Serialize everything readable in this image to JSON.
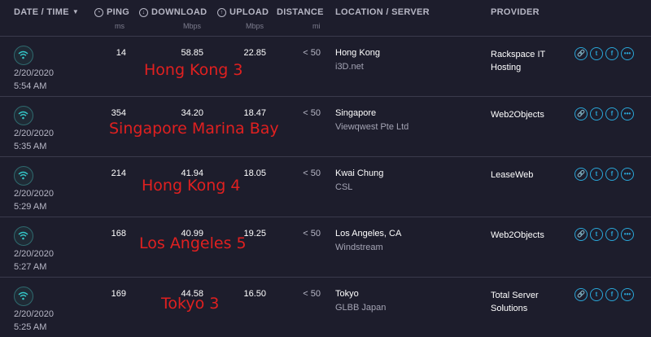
{
  "header": {
    "date_time": "DATE / TIME",
    "ping": "PING",
    "ping_unit": "ms",
    "download": "DOWNLOAD",
    "download_unit": "Mbps",
    "upload": "UPLOAD",
    "upload_unit": "Mbps",
    "distance": "DISTANCE",
    "distance_unit": "mi",
    "location": "LOCATION / SERVER",
    "provider": "PROVIDER"
  },
  "rows": [
    {
      "date": "2/20/2020",
      "time": "5:54 AM",
      "ping": "14",
      "download": "58.85",
      "upload": "22.85",
      "distance": "< 50",
      "location": "Hong Kong",
      "server": "i3D.net",
      "provider_line1": "Rackspace IT",
      "provider_line2": "Hosting",
      "annotation": "Hong Kong 3"
    },
    {
      "date": "2/20/2020",
      "time": "5:35 AM",
      "ping": "354",
      "download": "34.20",
      "upload": "18.47",
      "distance": "< 50",
      "location": "Singapore",
      "server": "Viewqwest Pte Ltd",
      "provider_line1": "Web2Objects",
      "provider_line2": "",
      "annotation": "Singapore Marina Bay"
    },
    {
      "date": "2/20/2020",
      "time": "5:29 AM",
      "ping": "214",
      "download": "41.94",
      "upload": "18.05",
      "distance": "< 50",
      "location": "Kwai Chung",
      "server": "CSL",
      "provider_line1": "LeaseWeb",
      "provider_line2": "",
      "annotation": "Hong Kong 4"
    },
    {
      "date": "2/20/2020",
      "time": "5:27 AM",
      "ping": "168",
      "download": "40.99",
      "upload": "19.25",
      "distance": "< 50",
      "location": "Los Angeles, CA",
      "server": "Windstream",
      "provider_line1": "Web2Objects",
      "provider_line2": "",
      "annotation": "Los Angeles 5"
    },
    {
      "date": "2/20/2020",
      "time": "5:25 AM",
      "ping": "169",
      "download": "44.58",
      "upload": "16.50",
      "distance": "< 50",
      "location": "Tokyo",
      "server": "GLBB Japan",
      "provider_line1": "Total Server",
      "provider_line2": "Solutions",
      "annotation": "Tokyo 3"
    }
  ],
  "icons": {
    "sort": "caret-down",
    "result_type": "wifi-icon",
    "actions": [
      "link-icon",
      "twitter-icon",
      "facebook-icon",
      "more-icon"
    ]
  },
  "colors": {
    "background": "#1d1d2c",
    "accent": "#2aa6d8",
    "annotation": "#e02020"
  }
}
